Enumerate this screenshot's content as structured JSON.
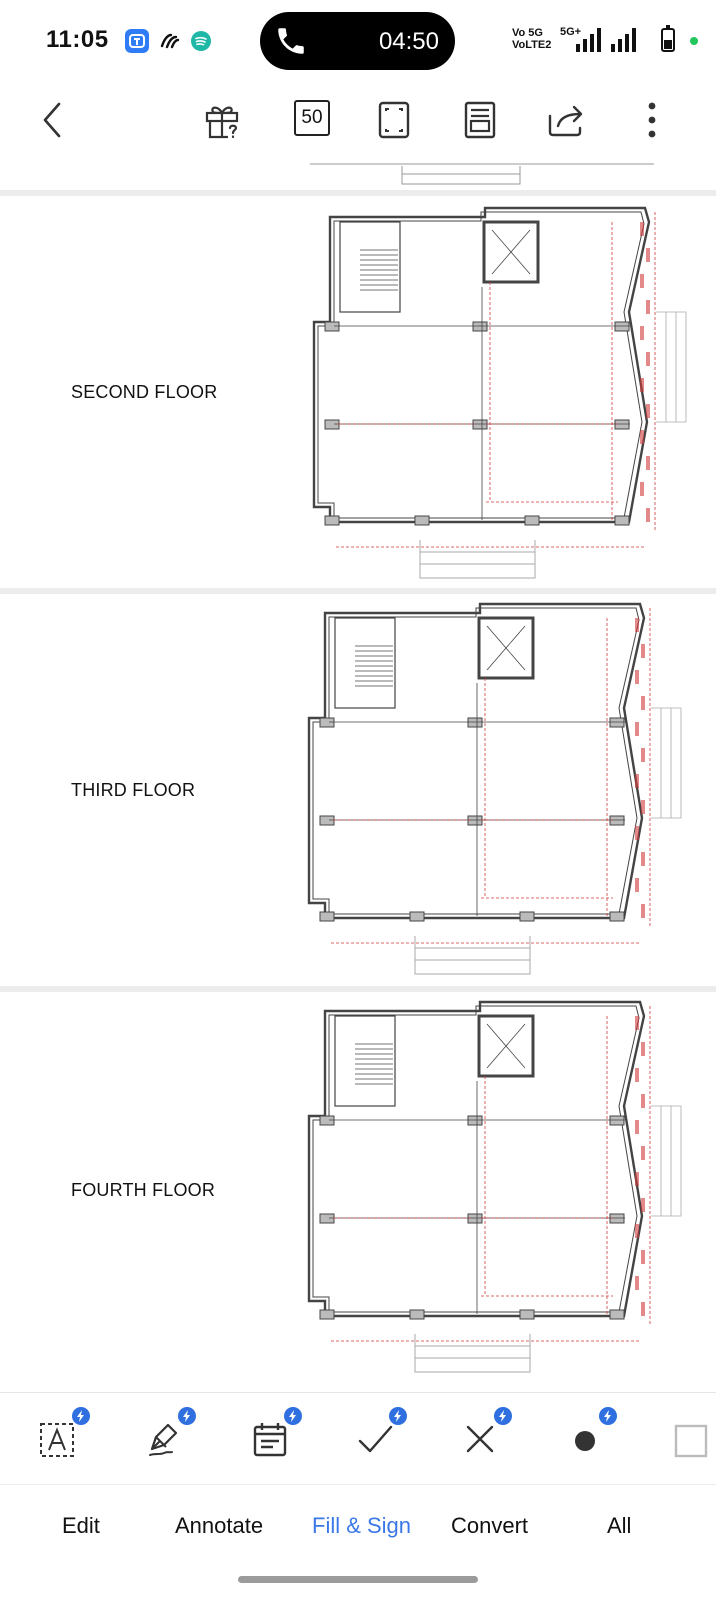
{
  "status_bar": {
    "time": "11:05",
    "call_duration": "04:50",
    "network_1_top": "Vo 5G",
    "network_1_bottom": "VoLTE2",
    "network_2": "5G+"
  },
  "toolbar": {
    "page_count": "50",
    "icons": [
      "back-arrow-icon",
      "gift-help-icon",
      "page-count-icon",
      "fullscreen-icon",
      "reading-mode-icon",
      "share-icon",
      "more-vertical-icon"
    ]
  },
  "document": {
    "floors": [
      {
        "label": "SECOND FLOOR"
      },
      {
        "label": "THIRD FLOOR"
      },
      {
        "label": "FOURTH FLOOR"
      }
    ]
  },
  "tools": {
    "items": [
      "text-box-icon",
      "pen-sign-icon",
      "date-calendar-icon",
      "checkmark-icon",
      "cross-icon",
      "dot-icon",
      "rectangle-icon"
    ]
  },
  "tabs": {
    "items": [
      {
        "label": "Edit"
      },
      {
        "label": "Annotate"
      },
      {
        "label": "Fill & Sign"
      },
      {
        "label": "Convert"
      },
      {
        "label": "All"
      }
    ],
    "active": "Fill & Sign",
    "active_color": "#3b78e7"
  },
  "colors": {
    "accent": "#3b78e7",
    "badge": "#2f6fe0",
    "plan_lines": "#444444",
    "dimension_lines": "#d23a3a"
  }
}
